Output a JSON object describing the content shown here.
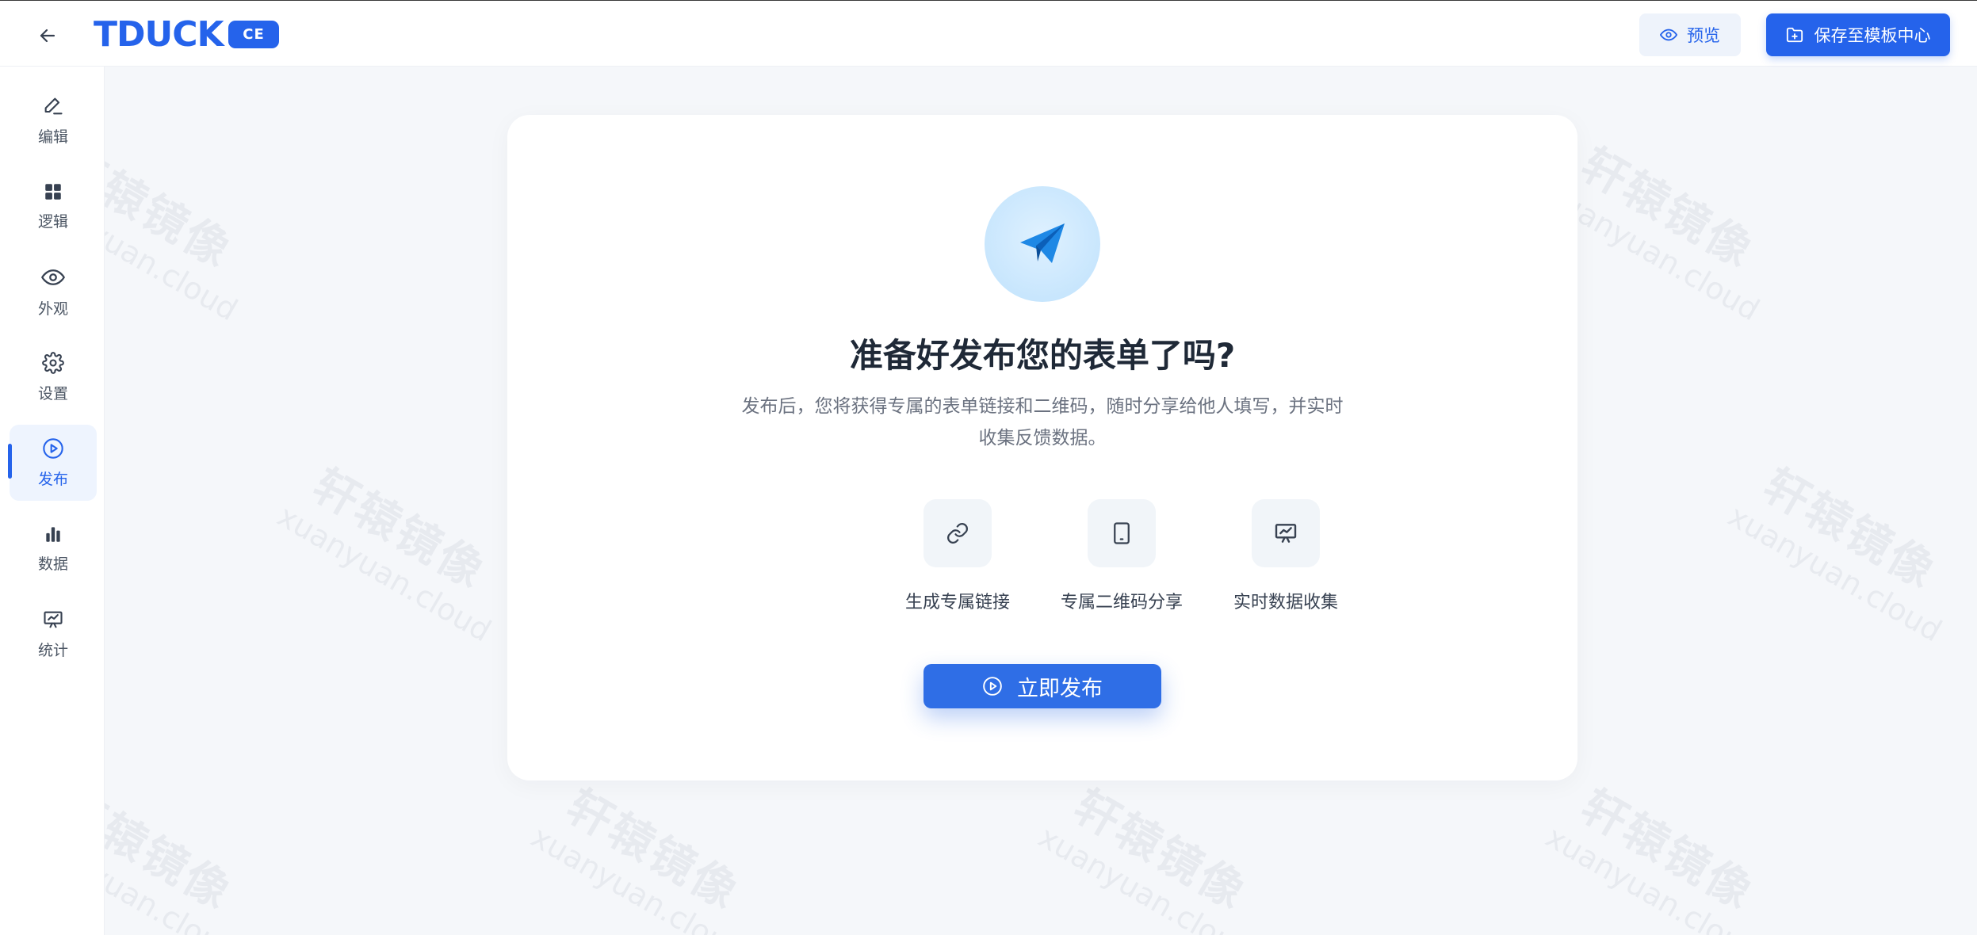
{
  "header": {
    "logo": "TDUCK",
    "badge": "CE",
    "preview_label": "预览",
    "save_label": "保存至模板中心"
  },
  "sidebar": {
    "items": [
      {
        "label": "编辑",
        "icon": "pen-icon"
      },
      {
        "label": "逻辑",
        "icon": "grid-icon"
      },
      {
        "label": "外观",
        "icon": "eye-icon"
      },
      {
        "label": "设置",
        "icon": "gear-icon"
      },
      {
        "label": "发布",
        "icon": "play-circle-icon",
        "active": true
      },
      {
        "label": "数据",
        "icon": "bar-chart-icon"
      },
      {
        "label": "统计",
        "icon": "presentation-chart-icon"
      }
    ]
  },
  "main": {
    "title": "准备好发布您的表单了吗?",
    "description": "发布后，您将获得专属的表单链接和二维码，随时分享给他人填写，并实时收集反馈数据。",
    "features": [
      {
        "label": "生成专属链接",
        "icon": "link-icon"
      },
      {
        "label": "专属二维码分享",
        "icon": "tablet-icon"
      },
      {
        "label": "实时数据收集",
        "icon": "presentation-chart-icon"
      }
    ],
    "publish_label": "立即发布"
  },
  "watermark": {
    "cn": "轩辕镜像",
    "en": "xuanyuan.cloud"
  },
  "colors": {
    "accent": "#2563eb",
    "background": "#f5f7fa",
    "active_bg": "#eef4fe"
  }
}
